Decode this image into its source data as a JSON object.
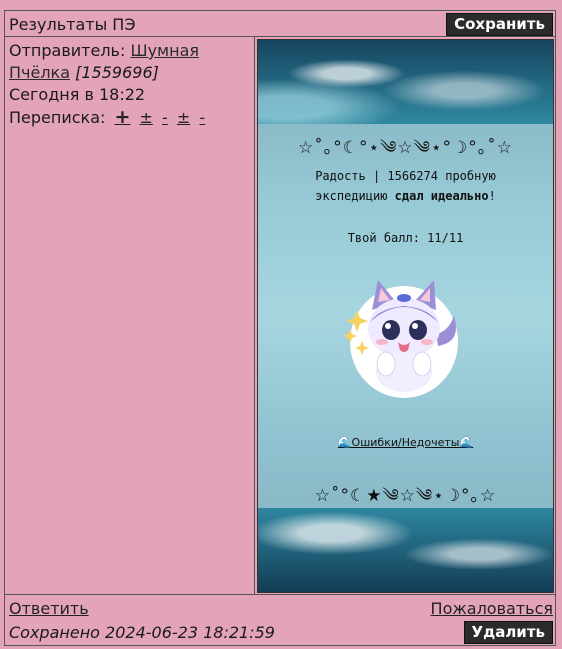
{
  "header": {
    "title": "Результаты ПЭ",
    "save_label": "Сохранить"
  },
  "meta": {
    "sender_label": "Отправитель:",
    "sender_name_1": "Шумная",
    "sender_name_2": "Пчёлка",
    "sender_id": "[1559696]",
    "date": "Сегодня в 18:22",
    "correspondence_label": "Переписка:",
    "correspondence_links": [
      "+",
      "±",
      "-",
      "±",
      "-"
    ]
  },
  "card": {
    "deco_top": "☆˚｡°☾°⋆༄☆༄⋆°☽°｡˚☆",
    "deco_bottom": "☆˚°☾★༄☆༄⋆☽°｡☆",
    "line1": "Радость | 1566274 пробную",
    "line2_pre": "экспедицию ",
    "line2_bold": "сдал идеально",
    "line2_post": "!",
    "score": "Твой балл: 11/11",
    "error_link": "Ошибки/Недочеты",
    "wave_icon": "🌊"
  },
  "footer": {
    "reply": "Ответить",
    "report": "Пожаловаться",
    "saved": "Сохранено 2024-06-23 18:21:59",
    "delete_label": "Удалить"
  },
  "colors": {
    "background": "#e3a4b7",
    "button": "#2b2b2b"
  }
}
